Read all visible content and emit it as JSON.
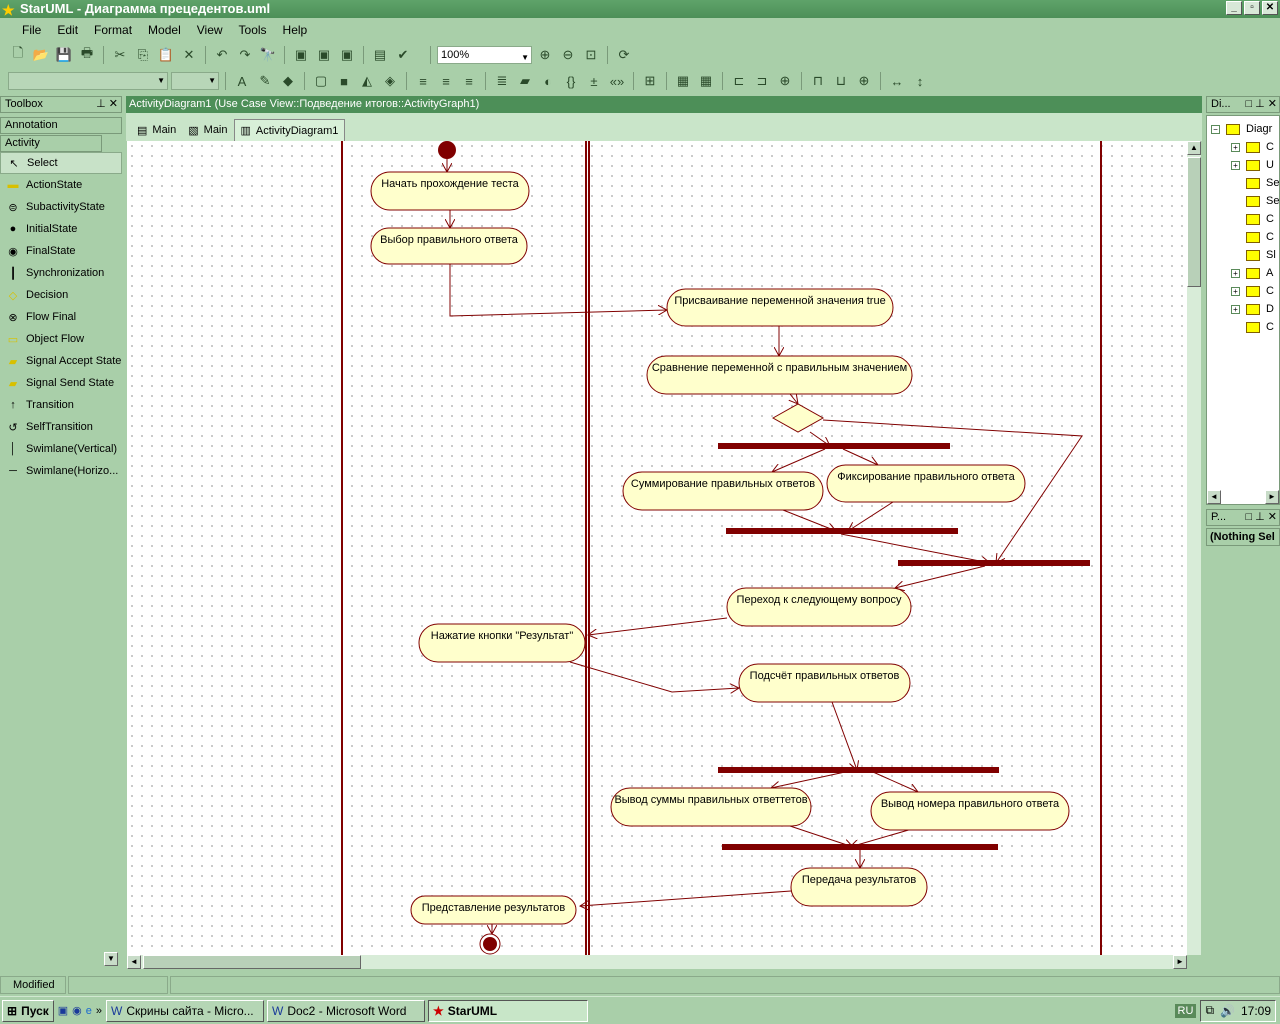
{
  "window": {
    "title": "StarUML - Диаграмма прецедентов.uml",
    "min": "_",
    "max": "▫",
    "close": "✕"
  },
  "menu": [
    "File",
    "Edit",
    "Format",
    "Model",
    "View",
    "Tools",
    "Help"
  ],
  "toolbar": {
    "zoom_value": "100%"
  },
  "toolbox": {
    "title": "Toolbox",
    "sections": [
      "Annotation",
      "Activity"
    ],
    "items": [
      {
        "label": "Select",
        "icon": "pointer-icon"
      },
      {
        "label": "ActionState",
        "icon": "action-state-icon"
      },
      {
        "label": "SubactivityState",
        "icon": "subactivity-icon"
      },
      {
        "label": "InitialState",
        "icon": "initial-state-icon"
      },
      {
        "label": "FinalState",
        "icon": "final-state-icon"
      },
      {
        "label": "Synchronization",
        "icon": "synchronization-icon"
      },
      {
        "label": "Decision",
        "icon": "decision-icon"
      },
      {
        "label": "Flow Final",
        "icon": "flow-final-icon"
      },
      {
        "label": "Object Flow",
        "icon": "object-flow-icon"
      },
      {
        "label": "Signal Accept State",
        "icon": "signal-accept-icon"
      },
      {
        "label": "Signal Send State",
        "icon": "signal-send-icon"
      },
      {
        "label": "Transition",
        "icon": "transition-icon"
      },
      {
        "label": "SelfTransition",
        "icon": "self-transition-icon"
      },
      {
        "label": "Swimlane(Vertical)",
        "icon": "swimlane-vertical-icon"
      },
      {
        "label": "Swimlane(Horizo...",
        "icon": "swimlane-horizontal-icon"
      }
    ]
  },
  "document": {
    "header": "ActivityDiagram1 (Use Case View::Подведение итогов::ActivityGraph1)",
    "tabs": [
      "Main",
      "Main",
      "ActivityDiagram1"
    ]
  },
  "diagram": {
    "colors": {
      "fill": "#ffffcc",
      "stroke": "#800000",
      "bar": "#800000"
    },
    "states": [
      "Начать прохождение теста",
      "Выбор правильного ответа",
      "Присваивание переменной значения true",
      "Сравнение переменной с правильным значением",
      "Суммирование правильных ответов",
      "Фиксирование правильного ответа",
      "Переход к следующему вопросу",
      "Нажатие кнопки \"Результат\"",
      "Подсчёт правильных ответов",
      "Вывод суммы правильных ответтетов",
      "Вывод номера правильного ответа",
      "Передача результатов",
      "Представление результатов"
    ]
  },
  "explorer": {
    "title": "Di...",
    "root": "Diagr",
    "children": [
      {
        "label": "C",
        "expandable": true
      },
      {
        "label": "U",
        "expandable": true
      },
      {
        "label": "Se",
        "expandable": false
      },
      {
        "label": "Se",
        "expandable": false
      },
      {
        "label": "C",
        "expandable": false
      },
      {
        "label": "C",
        "expandable": false
      },
      {
        "label": "Sl",
        "expandable": false
      },
      {
        "label": "A",
        "expandable": true
      },
      {
        "label": "C",
        "expandable": true
      },
      {
        "label": "D",
        "expandable": true
      },
      {
        "label": "C",
        "expandable": false
      }
    ]
  },
  "properties": {
    "title": "P...",
    "selection": "(Nothing Sel"
  },
  "status": {
    "state": "Modified"
  },
  "taskbar": {
    "start": "Пуск",
    "tasks": [
      {
        "label": "Скрины сайта - Micro...",
        "active": false
      },
      {
        "label": "Doc2 - Microsoft Word",
        "active": false
      },
      {
        "label": "StarUML",
        "active": true
      }
    ],
    "lang": "RU",
    "clock": "17:09"
  }
}
